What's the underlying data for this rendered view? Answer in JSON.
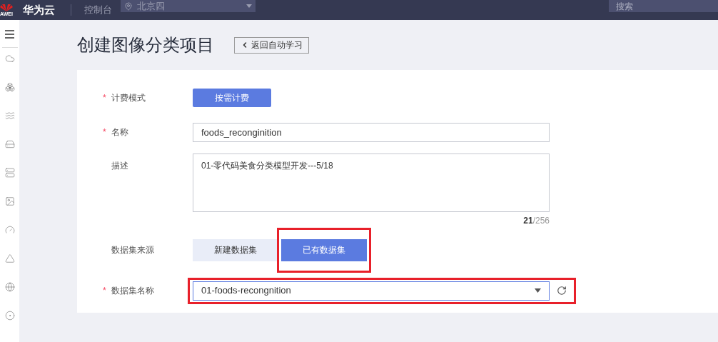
{
  "topbar": {
    "logo_text": "AWEI",
    "brand": "华为云",
    "console": "控制台",
    "region": "北京四",
    "search_placeholder": "搜索"
  },
  "page": {
    "title": "创建图像分类项目",
    "back_button": "返回自动学习"
  },
  "required_mark": "*",
  "form": [
    {
      "kind": "button",
      "label": "计费模式",
      "required": true,
      "value": "按需计费"
    },
    {
      "kind": "input",
      "label": "名称",
      "required": true,
      "value": "foods_reconginition"
    },
    {
      "kind": "textarea",
      "label": "描述",
      "required": false,
      "value": "01-零代码美食分类模型开发---5/18",
      "counter": "**21**/256"
    },
    {
      "kind": "segmented",
      "label": "数据集来源",
      "required": false,
      "highlighted": true,
      "options": [
        {
          "label": "新建数据集",
          "selected": false
        },
        {
          "label": "已有数据集",
          "selected": true
        }
      ]
    },
    {
      "kind": "select",
      "label": "数据集名称",
      "required": true,
      "highlighted": true,
      "value": "01-foods-recongnition"
    }
  ]
}
